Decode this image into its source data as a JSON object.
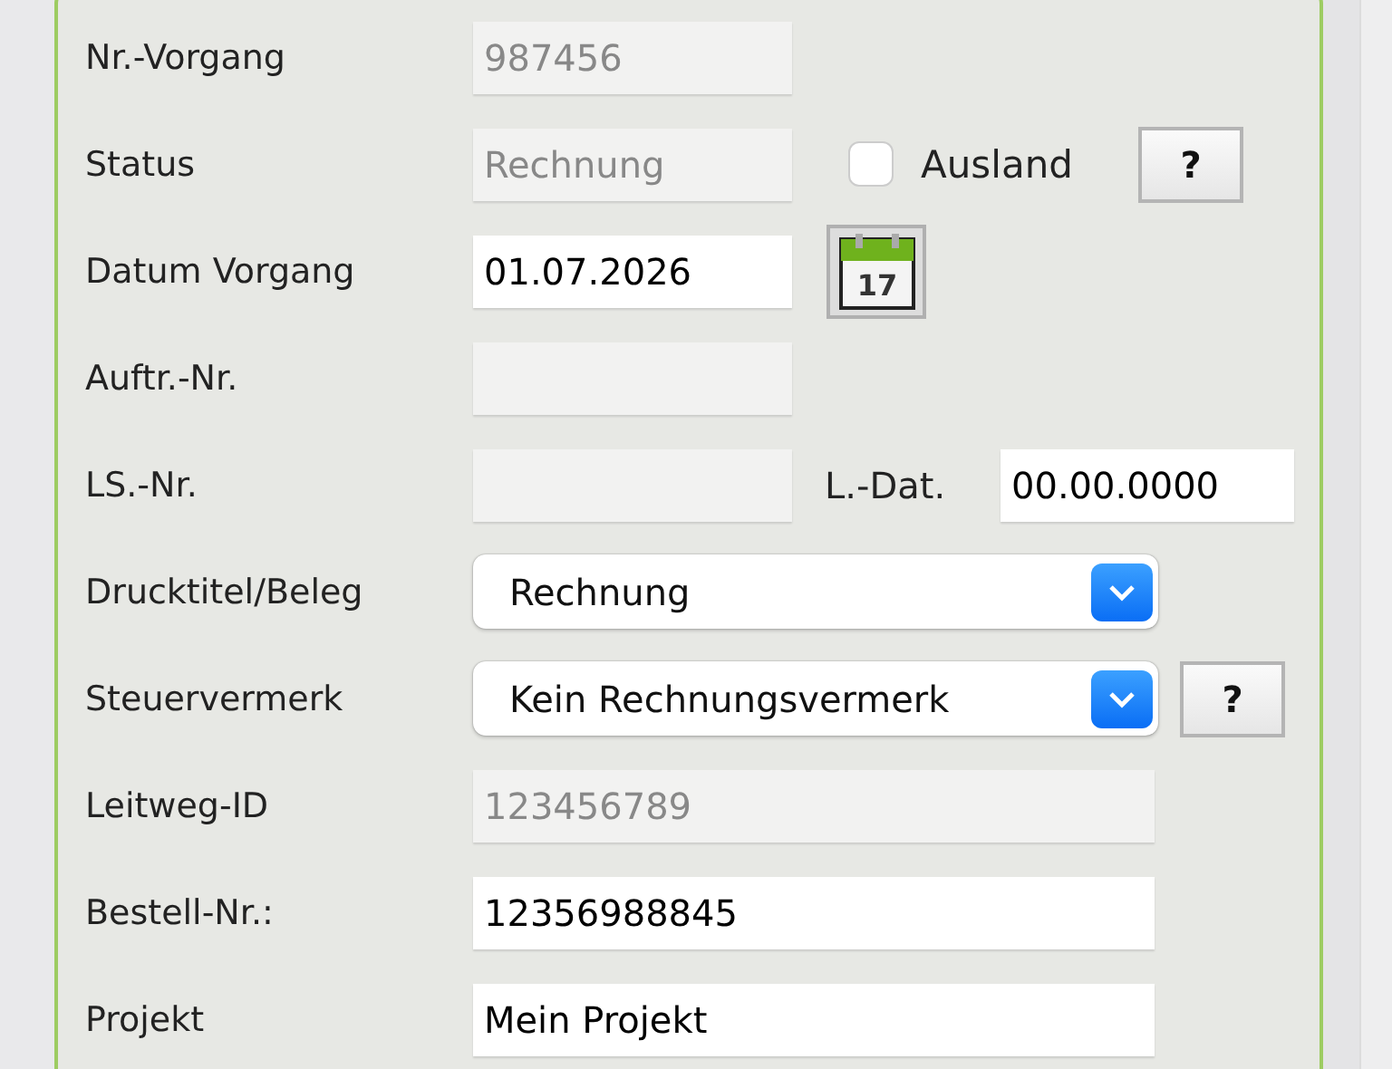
{
  "rows": [
    {
      "label": "Nr.-Vorgang",
      "field": {
        "kind": "text",
        "value": "987456",
        "disabled": true
      },
      "extras": []
    },
    {
      "label": "Status",
      "field": {
        "kind": "text",
        "value": "Rechnung",
        "disabled": true
      },
      "extras": [
        {
          "kind": "checkbox",
          "label": "Ausland",
          "checked": false
        },
        {
          "kind": "help",
          "text": "?"
        }
      ]
    },
    {
      "label": "Datum Vorgang",
      "field": {
        "kind": "text",
        "value": "01.07.2026",
        "disabled": false
      },
      "extras": [
        {
          "kind": "calendar",
          "text": "17"
        }
      ]
    },
    {
      "label": "Auftr.-Nr.",
      "field": {
        "kind": "text",
        "disabled": true
      },
      "extras": []
    },
    {
      "label": "LS.-Nr.",
      "field": {
        "kind": "text",
        "disabled": true
      },
      "extras": [
        {
          "kind": "date_field",
          "label": "L.-Dat.",
          "value": "00.00.0000"
        }
      ]
    },
    {
      "label": "Drucktitel/Beleg",
      "field": {
        "kind": "select",
        "value": "Rechnung"
      },
      "extras": []
    },
    {
      "label": "Steuervermerk",
      "field": {
        "kind": "select",
        "value": "Kein Rechnungsvermerk"
      },
      "extras": [
        {
          "kind": "help",
          "text": "?"
        }
      ]
    },
    {
      "label": "Leitweg-ID",
      "field": {
        "kind": "wide_text",
        "value": "123456789",
        "disabled": true
      },
      "extras": []
    },
    {
      "label": "Bestell-Nr.:",
      "field": {
        "kind": "wide_text",
        "value": "12356988845",
        "disabled": false
      },
      "extras": []
    },
    {
      "label": "Projekt",
      "field": {
        "kind": "wide_text",
        "value": "Mein Projekt",
        "disabled": false
      },
      "extras": []
    }
  ]
}
